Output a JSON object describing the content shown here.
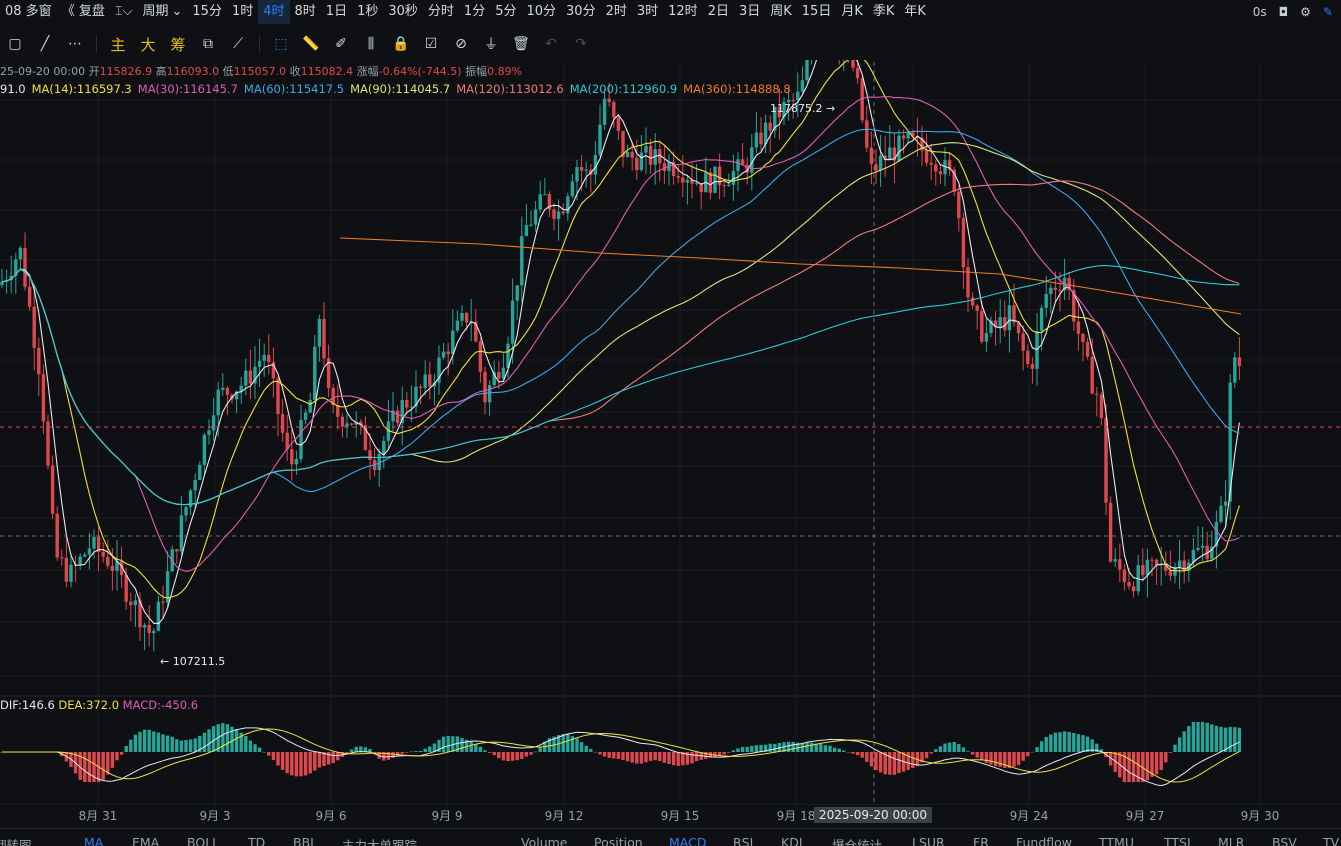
{
  "topbar": {
    "items": [
      "08 多窗",
      "《 复盘",
      "指标",
      "周期",
      "15分",
      "1时",
      "4时",
      "8时",
      "1日",
      "1秒",
      "30秒",
      "分时",
      "1分",
      "5分",
      "10分",
      "30分",
      "2时",
      "3时",
      "12时",
      "2日",
      "3日",
      "周K",
      "15日",
      "月K",
      "季K",
      "年K"
    ],
    "active": "4时",
    "timer": "0s"
  },
  "toolbar": {
    "main_label": "主",
    "big_label": "大",
    "chip_label": "筹"
  },
  "ohlc": {
    "date": "25-09-20 00:00",
    "open_label": "开",
    "open": "115826.9",
    "high_label": "高",
    "high": "116093.0",
    "low_label": "低",
    "low": "115057.0",
    "close_label": "收",
    "close": "115082.4",
    "change_label": "涨幅",
    "change": "-0.64%(-744.5)",
    "amp_label": "振幅",
    "amp": "0.89%"
  },
  "ma": [
    {
      "label": "91.0",
      "color": "#e7e9ee"
    },
    {
      "label": "MA(14):116597.3",
      "color": "#f0e040"
    },
    {
      "label": "MA(30):116145.7",
      "color": "#e05cb8"
    },
    {
      "label": "MA(60):115417.5",
      "color": "#3aa8e8"
    },
    {
      "label": "MA(90):114045.7",
      "color": "#d6e67a"
    },
    {
      "label": "MA(120):113012.6",
      "color": "#f07a7a"
    },
    {
      "label": "MA(200):112960.9",
      "color": "#2ec8d8"
    },
    {
      "label": "MA(360):114888.8",
      "color": "#f07a28"
    }
  ],
  "annotations": {
    "high": "117875.2",
    "low": "107211.5"
  },
  "macd": {
    "dif": "DIF:146.6",
    "dea": "DEA:372.0",
    "macd": "MACD:-450.6"
  },
  "xaxis": {
    "ticks": [
      "8月 31",
      "9月 3",
      "9月 6",
      "9月 9",
      "9月 12",
      "9月 15",
      "9月 18",
      "9月 24",
      "9月 27",
      "9月 30"
    ],
    "cursor": "2025-09-20 00:00"
  },
  "bottombar": [
    "翻转图",
    "MA",
    "EMA",
    "BOLL",
    "TD",
    "BBI",
    "主力大单跟踪",
    "Volume",
    "Position",
    "MACD",
    "RSI",
    "KDJ",
    "爆仓统计",
    "LSUR",
    "FR",
    "Fundflow",
    "TTMU",
    "TTSI",
    "MLR",
    "BSV",
    "TV"
  ],
  "bottom_active": [
    "MA",
    "MACD"
  ],
  "colors": {
    "up": "#26a69a",
    "down": "#e0484f",
    "accent": "#2f7ef5"
  }
}
